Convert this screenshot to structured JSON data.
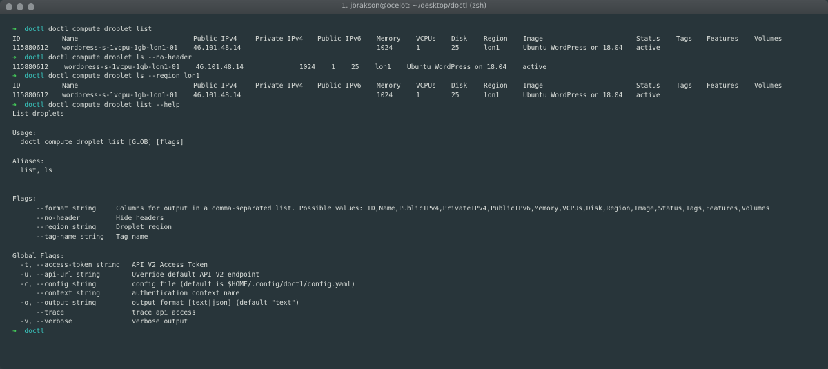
{
  "window": {
    "title": "1. jbrakson@ocelot: ~/desktop/doctl (zsh)"
  },
  "prompt": {
    "arrow": "➜",
    "dir": "doctl"
  },
  "blocks": [
    {
      "cmd": "doctl compute droplet list",
      "header": [
        "ID",
        "Name",
        "Public IPv4",
        "Private IPv4",
        "Public IPv6",
        "Memory",
        "VCPUs",
        "Disk",
        "Region",
        "Image",
        "Status",
        "Tags",
        "Features",
        "Volumes"
      ],
      "row": [
        "115880612",
        "wordpress-s-1vcpu-1gb-lon1-01",
        "46.101.48.14",
        "",
        "",
        "1024",
        "1",
        "25",
        "lon1",
        "Ubuntu WordPress on 18.04",
        "active",
        "",
        "",
        ""
      ]
    },
    {
      "cmd": "doctl compute droplet ls --no-header",
      "raw": "115880612    wordpress-s-1vcpu-1gb-lon1-01    46.101.48.14              1024    1    25    lon1    Ubuntu WordPress on 18.04    active"
    },
    {
      "cmd": "doctl compute droplet ls --region lon1",
      "header": [
        "ID",
        "Name",
        "Public IPv4",
        "Private IPv4",
        "Public IPv6",
        "Memory",
        "VCPUs",
        "Disk",
        "Region",
        "Image",
        "Status",
        "Tags",
        "Features",
        "Volumes"
      ],
      "row": [
        "115880612",
        "wordpress-s-1vcpu-1gb-lon1-01",
        "46.101.48.14",
        "",
        "",
        "1024",
        "1",
        "25",
        "lon1",
        "Ubuntu WordPress on 18.04",
        "active",
        "",
        "",
        ""
      ]
    },
    {
      "cmd": "doctl compute droplet list --help"
    }
  ],
  "help": [
    "List droplets",
    "",
    "Usage:",
    "  doctl compute droplet list [GLOB] [flags]",
    "",
    "Aliases:",
    "  list, ls",
    "",
    "",
    "Flags:",
    "      --format string     Columns for output in a comma-separated list. Possible values: ID,Name,PublicIPv4,PrivateIPv4,PublicIPv6,Memory,VCPUs,Disk,Region,Image,Status,Tags,Features,Volumes",
    "      --no-header         Hide headers",
    "      --region string     Droplet region",
    "      --tag-name string   Tag name",
    "",
    "Global Flags:",
    "  -t, --access-token string   API V2 Access Token",
    "  -u, --api-url string        Override default API V2 endpoint",
    "  -c, --config string         config file (default is $HOME/.config/doctl/config.yaml)",
    "      --context string        authentication context name",
    "  -o, --output string         output format [text|json] (default \"text\")",
    "      --trace                 trace api access",
    "  -v, --verbose               verbose output"
  ]
}
